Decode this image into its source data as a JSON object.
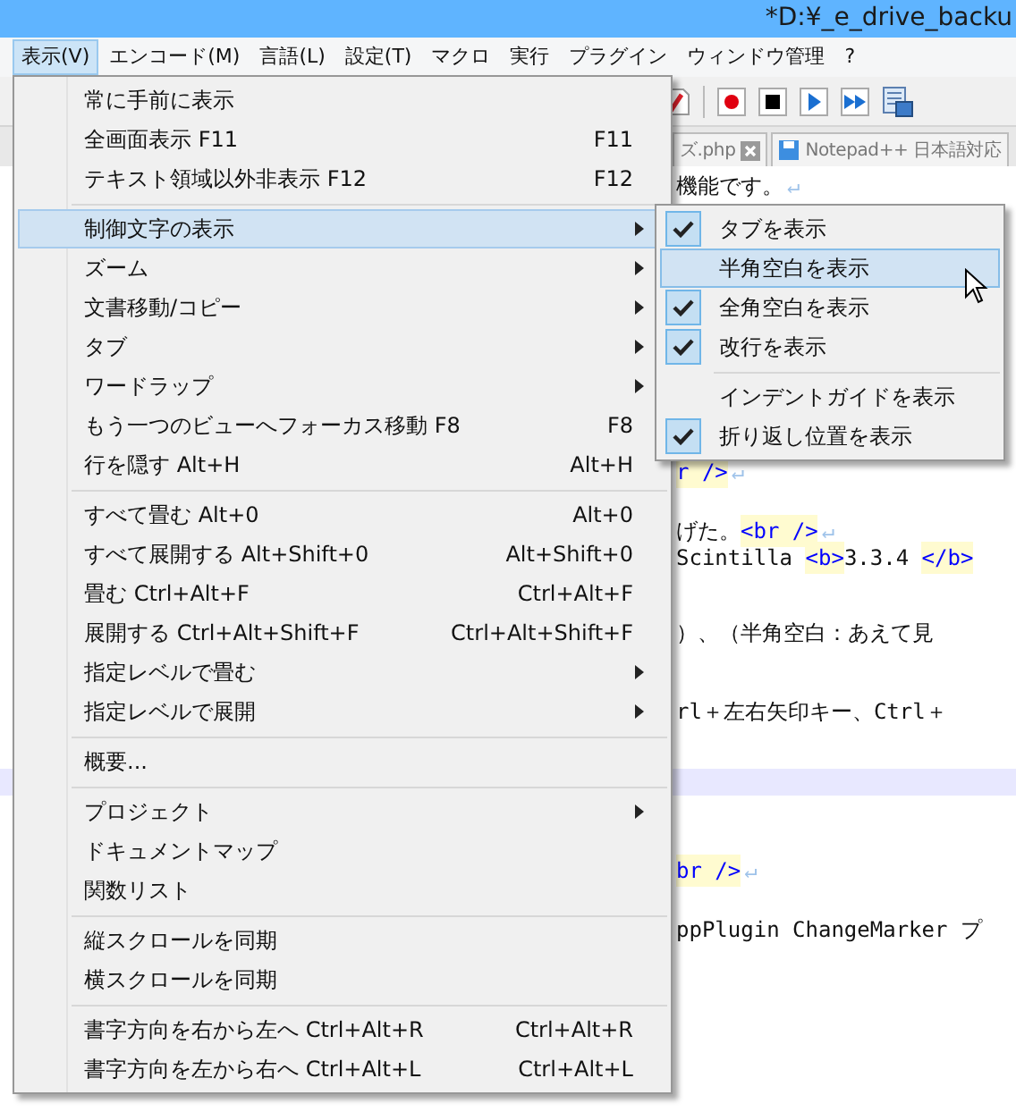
{
  "window": {
    "title": "*D:¥_e_drive_backu"
  },
  "menu_bar": [
    {
      "label": "表示(V)",
      "selected": true
    },
    {
      "label": "エンコード(M)",
      "selected": false
    },
    {
      "label": "言語(L)",
      "selected": false
    },
    {
      "label": "設定(T)",
      "selected": false
    },
    {
      "label": "マクロ",
      "selected": false
    },
    {
      "label": "実行",
      "selected": false
    },
    {
      "label": "プラグイン",
      "selected": false
    },
    {
      "label": "ウィンドウ管理",
      "selected": false
    },
    {
      "label": "?",
      "selected": false
    }
  ],
  "file_tabs": [
    {
      "label": "ズ.php",
      "kind": "closable"
    },
    {
      "label": "Notepad++ 日本語対応",
      "kind": "saved"
    }
  ],
  "editor_lines": [
    {
      "segments": [
        {
          "text": "機能です。",
          "kind": "text"
        },
        {
          "text": "↵",
          "kind": "eol"
        }
      ]
    },
    {
      "segments": [
        {
          "text": "r />",
          "kind": "tag"
        },
        {
          "text": "↵",
          "kind": "eol"
        }
      ]
    },
    {
      "segments": [
        {
          "text": "げた。",
          "kind": "text"
        },
        {
          "text": "<br />",
          "kind": "tag"
        },
        {
          "text": "↵",
          "kind": "eol"
        }
      ]
    },
    {
      "segments": [
        {
          "text": "Scintilla ",
          "kind": "text"
        },
        {
          "text": "<b>",
          "kind": "tag"
        },
        {
          "text": "3.3.4 ",
          "kind": "text"
        },
        {
          "text": "</b>",
          "kind": "tag"
        }
      ]
    },
    {
      "segments": [
        {
          "text": "）、（半角空白：あえて見",
          "kind": "text"
        }
      ]
    },
    {
      "segments": [
        {
          "text": "rl＋左右矢印キー、Ctrl＋",
          "kind": "text"
        }
      ]
    },
    {
      "kind": "current"
    },
    {
      "segments": [
        {
          "text": "br />",
          "kind": "tag"
        },
        {
          "text": "↵",
          "kind": "eol"
        }
      ]
    },
    {
      "segments": [
        {
          "text": "ppPlugin ChangeMarker プ",
          "kind": "text"
        }
      ]
    }
  ],
  "view_menu": [
    {
      "kind": "item",
      "label": "常に手前に表示",
      "selected": false,
      "submenu": false
    },
    {
      "kind": "item",
      "label": "全画面表示 F11",
      "shortcut": "F11",
      "selected": false,
      "submenu": false
    },
    {
      "kind": "item",
      "label": "テキスト領域以外非表示 F12",
      "shortcut": "F12",
      "selected": false,
      "submenu": false
    },
    {
      "kind": "separator"
    },
    {
      "kind": "item",
      "label": "制御文字の表示",
      "selected": true,
      "submenu": true
    },
    {
      "kind": "item",
      "label": "ズーム",
      "selected": false,
      "submenu": true
    },
    {
      "kind": "item",
      "label": "文書移動/コピー",
      "selected": false,
      "submenu": true
    },
    {
      "kind": "item",
      "label": "タブ",
      "selected": false,
      "submenu": true
    },
    {
      "kind": "item",
      "label": "ワードラップ",
      "selected": false,
      "submenu": true
    },
    {
      "kind": "item",
      "label": "もう一つのビューへフォーカス移動 F8",
      "shortcut": "F8",
      "selected": false,
      "submenu": false
    },
    {
      "kind": "item",
      "label": "行を隠す Alt+H",
      "shortcut": "Alt+H",
      "selected": false,
      "submenu": false
    },
    {
      "kind": "separator"
    },
    {
      "kind": "item",
      "label": "すべて畳む Alt+0",
      "shortcut": "Alt+0",
      "selected": false,
      "submenu": false
    },
    {
      "kind": "item",
      "label": "すべて展開する Alt+Shift+0",
      "shortcut": "Alt+Shift+0",
      "selected": false,
      "submenu": false
    },
    {
      "kind": "item",
      "label": "畳む Ctrl+Alt+F",
      "shortcut": "Ctrl+Alt+F",
      "selected": false,
      "submenu": false
    },
    {
      "kind": "item",
      "label": "展開する Ctrl+Alt+Shift+F",
      "shortcut": "Ctrl+Alt+Shift+F",
      "selected": false,
      "submenu": false
    },
    {
      "kind": "item",
      "label": "指定レベルで畳む",
      "selected": false,
      "submenu": true
    },
    {
      "kind": "item",
      "label": "指定レベルで展開",
      "selected": false,
      "submenu": true
    },
    {
      "kind": "separator"
    },
    {
      "kind": "item",
      "label": "概要...",
      "selected": false,
      "submenu": false
    },
    {
      "kind": "separator"
    },
    {
      "kind": "item",
      "label": "プロジェクト",
      "selected": false,
      "submenu": true
    },
    {
      "kind": "item",
      "label": "ドキュメントマップ",
      "selected": false,
      "submenu": false
    },
    {
      "kind": "item",
      "label": "関数リスト",
      "selected": false,
      "submenu": false
    },
    {
      "kind": "separator"
    },
    {
      "kind": "item",
      "label": "縦スクロールを同期",
      "selected": false,
      "submenu": false
    },
    {
      "kind": "item",
      "label": "横スクロールを同期",
      "selected": false,
      "submenu": false
    },
    {
      "kind": "separator"
    },
    {
      "kind": "item",
      "label": "書字方向を右から左へ Ctrl+Alt+R",
      "shortcut": "Ctrl+Alt+R",
      "selected": false,
      "submenu": false
    },
    {
      "kind": "item",
      "label": "書字方向を左から右へ Ctrl+Alt+L",
      "shortcut": "Ctrl+Alt+L",
      "selected": false,
      "submenu": false
    }
  ],
  "control_chars_submenu": [
    {
      "kind": "item",
      "label": "タブを表示",
      "checked": true,
      "selected": false
    },
    {
      "kind": "item",
      "label": "半角空白を表示",
      "checked": false,
      "selected": true
    },
    {
      "kind": "item",
      "label": "全角空白を表示",
      "checked": true,
      "selected": false
    },
    {
      "kind": "item",
      "label": "改行を表示",
      "checked": true,
      "selected": false
    },
    {
      "kind": "separator"
    },
    {
      "kind": "item",
      "label": "インデントガイドを表示",
      "checked": false,
      "selected": false
    },
    {
      "kind": "item",
      "label": "折り返し位置を表示",
      "checked": true,
      "selected": false
    }
  ]
}
